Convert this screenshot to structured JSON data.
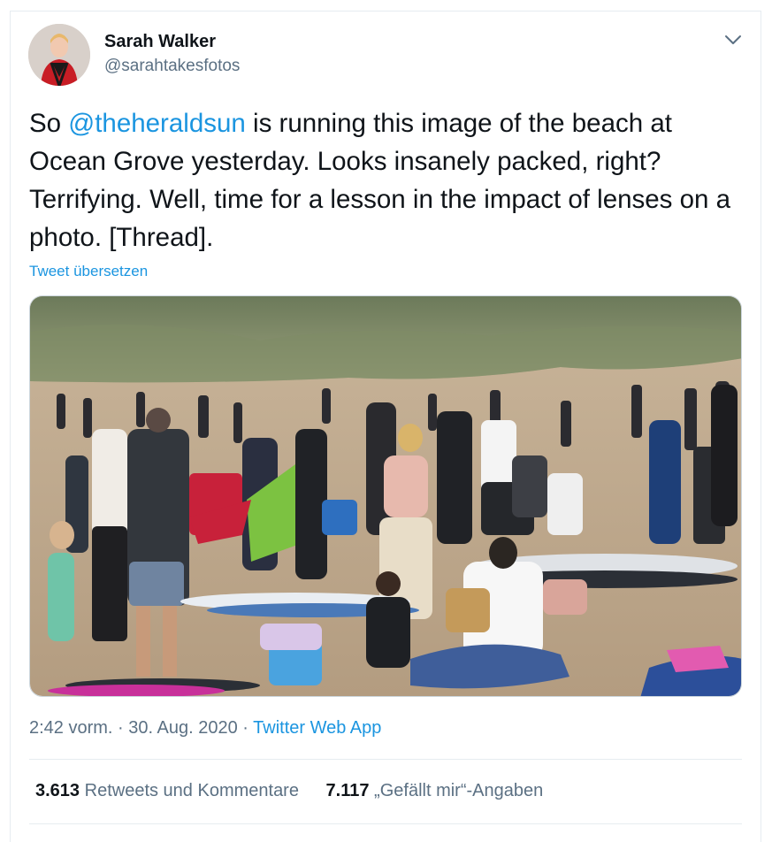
{
  "user": {
    "name": "Sarah Walker",
    "handle": "@sarahtakesfotos"
  },
  "tweet": {
    "text_before": "So ",
    "mention": "@theheraldsun",
    "text_after": " is running this image of the beach at Ocean Grove yesterday. Looks insanely packed, right? Terrifying. Well, time for a lesson in the impact of lenses on a photo. [Thread].",
    "translate_label": "Tweet übersetzen"
  },
  "meta": {
    "time": "2:42 vorm.",
    "sep1": " · ",
    "date": "30. Aug. 2020",
    "sep2": " · ",
    "source": "Twitter Web App"
  },
  "stats": {
    "retweets_count": "3.613",
    "retweets_label": "Retweets und Kommentare",
    "likes_count": "7.117",
    "likes_label": "„Gefällt mir“-Angaben"
  },
  "icons": {
    "more": "chevron-down-icon"
  },
  "colors": {
    "link": "#1b95e0",
    "secondary_text": "#5b7083",
    "primary_text": "#0f1419",
    "divider": "#e6ecf0"
  }
}
